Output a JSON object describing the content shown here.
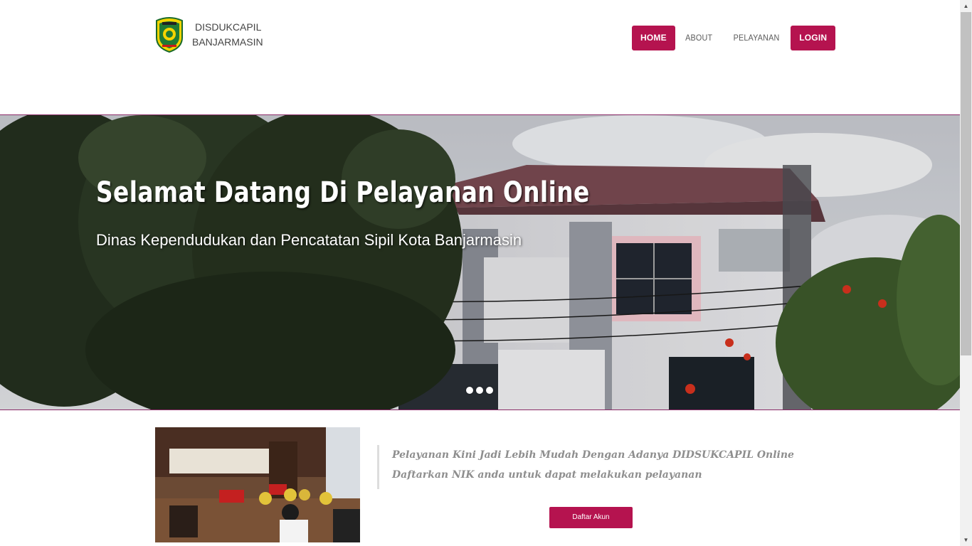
{
  "brand": {
    "name_line1": "DISDUKCAPIL",
    "name_line2": "BANJARMASIN",
    "logo_icon": "banjarmasin-crest-icon"
  },
  "nav": {
    "items": [
      {
        "label": "HOME",
        "active": true
      },
      {
        "label": "ABOUT",
        "active": false
      },
      {
        "label": "PELAYANAN",
        "active": false
      },
      {
        "label": "LOGIN",
        "active": true
      }
    ]
  },
  "hero": {
    "title": "Selamat Datang Di Pelayanan Online",
    "subtitle": "Dinas Kependudukan dan Pencatatan Sipil Kota Banjarmasin",
    "slide_count": 3
  },
  "intro": {
    "line1": "Pelayanan Kini Jadi Lebih Mudah Dengan Adanya DIDSUKCAPIL Online",
    "line2": "Daftarkan NIK anda untuk dapat melakukan pelayanan",
    "button_label": "Daftar Akun"
  },
  "colors": {
    "accent": "#b5134f",
    "hero_border": "#8a2a67",
    "quote_text": "#8e8e8e"
  }
}
